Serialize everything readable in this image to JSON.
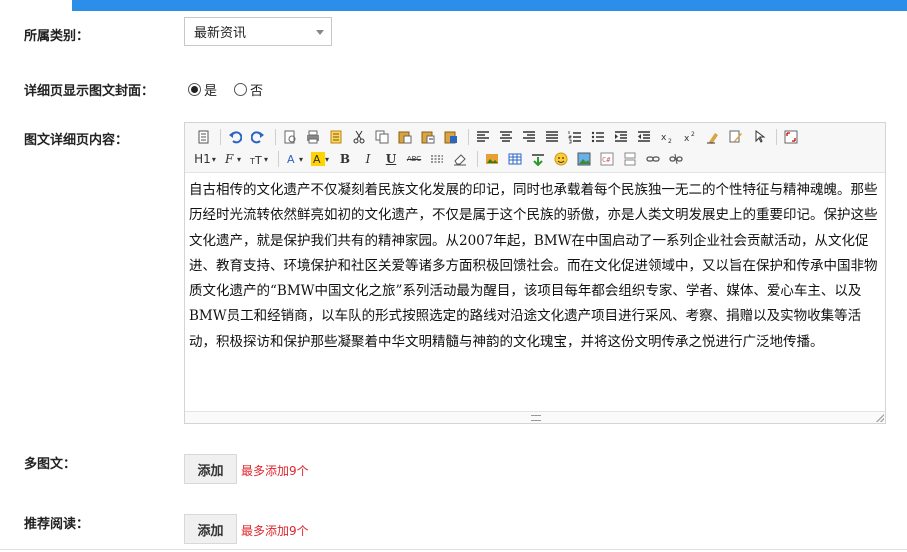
{
  "form": {
    "category": {
      "label": "所属类别：",
      "value": "最新资讯"
    },
    "cover": {
      "label": "详细页显示图文封面：",
      "options": [
        {
          "label": "是",
          "checked": true
        },
        {
          "label": "否",
          "checked": false
        }
      ]
    },
    "detail": {
      "label": "图文详细页内容："
    },
    "multi": {
      "label": "多图文：",
      "button": "添加",
      "hint": "最多添加9个"
    },
    "recommend": {
      "label": "推荐阅读：",
      "button": "添加",
      "hint": "最多添加9个"
    }
  },
  "editor": {
    "toolbar": {
      "heading_label": "H1",
      "bold": "B",
      "italic": "I",
      "underline": "U",
      "strike": "ABC"
    },
    "content": "自古相传的文化遗产不仅凝刻着民族文化发展的印记，同时也承载着每个民族独一无二的个性特征与精神魂魄。那些历经时光流转依然鲜亮如初的文化遗产，不仅是属于这个民族的骄傲，亦是人类文明发展史上的重要印记。保护这些文化遗产，就是保护我们共有的精神家园。从2007年起，BMW在中国启动了一系列企业社会贡献活动，从文化促进、教育支持、环境保护和社区关爱等诸多方面积极回馈社会。而在文化促进领域中，又以旨在保护和传承中国非物质文化遗产的“BMW中国文化之旅”系列活动最为醒目，该项目每年都会组织专家、学者、媒体、爱心车主、以及BMW员工和经销商，以车队的形式按照选定的路线对沿途文化遗产项目进行采风、考察、捐赠以及实物收集等活动，积极探访和保护那些凝聚着中华文明精髓与神韵的文化瑰宝，并将这份文明传承之悦进行广泛地传播。"
  }
}
